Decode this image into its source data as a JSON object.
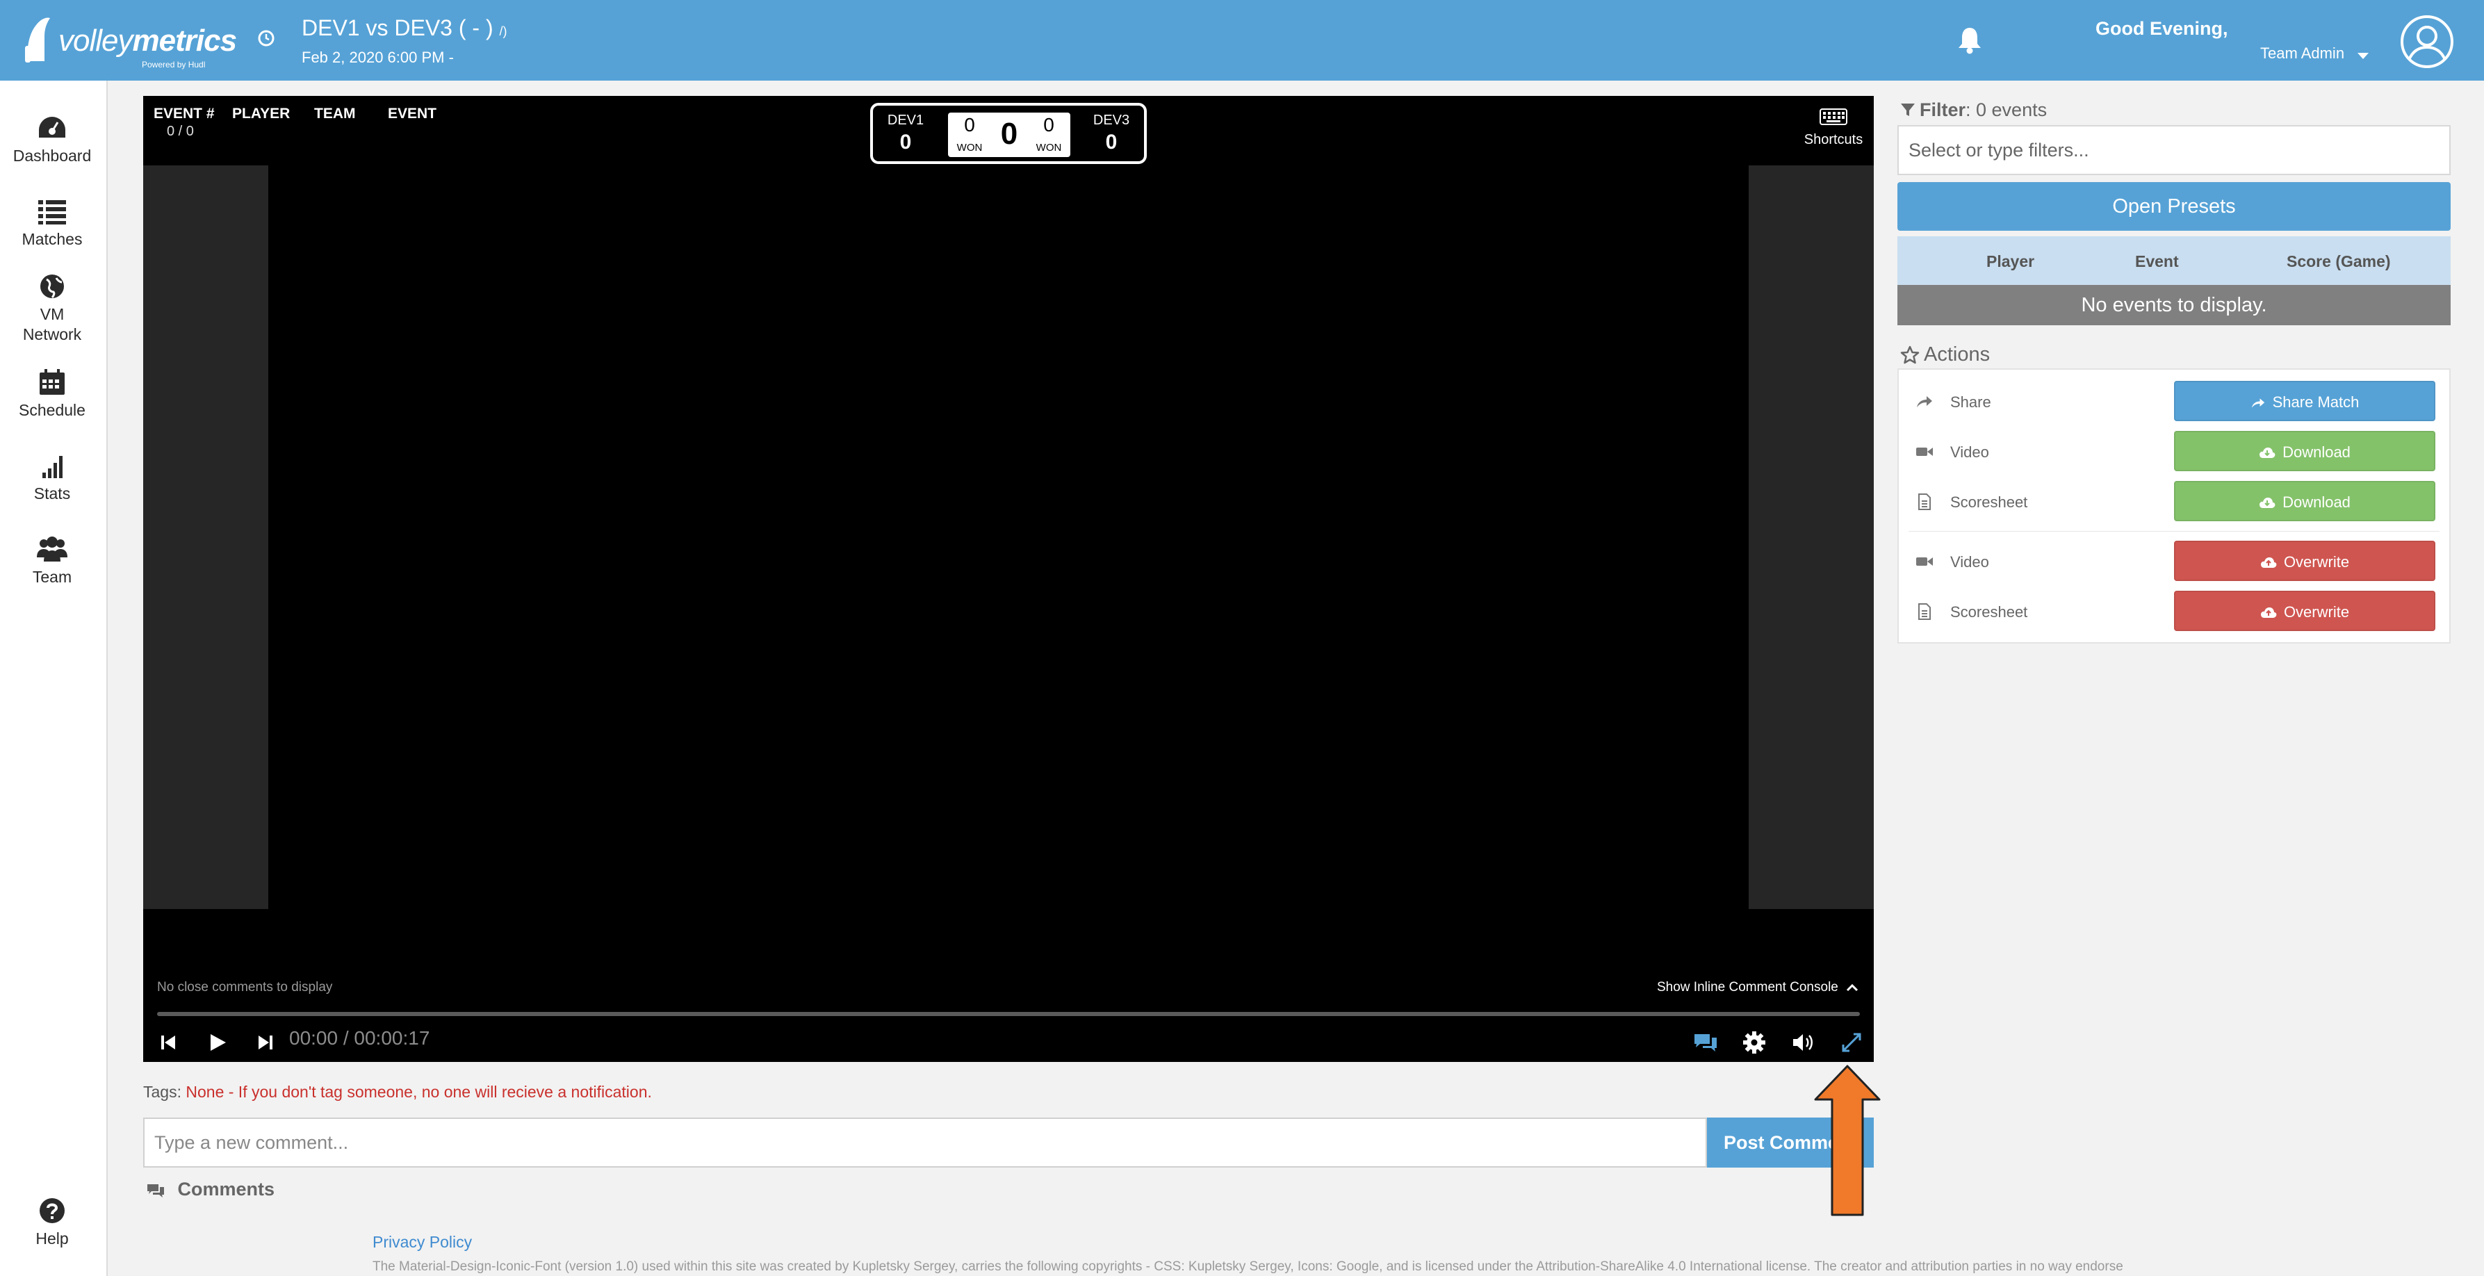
{
  "brand": {
    "name_prefix": "volley",
    "name_suffix": "metrics",
    "powered": "Powered by Hudl"
  },
  "header": {
    "match_title": "DEV1 vs DEV3 ( - )",
    "match_title_mark": "/)",
    "match_date": "Feb 2, 2020 6:00 PM -",
    "greeting": "Good Evening,",
    "user_role": "Team Admin",
    "colors": {
      "bar": "#56a2d6"
    }
  },
  "sidebar": {
    "items": [
      {
        "label": "Dashboard",
        "icon": "dashboard-icon"
      },
      {
        "label": "Matches",
        "icon": "list-icon"
      },
      {
        "label": "VM Network",
        "icon": "globe-icon"
      },
      {
        "label": "Schedule",
        "icon": "calendar-icon"
      },
      {
        "label": "Stats",
        "icon": "signal-bars-icon"
      },
      {
        "label": "Team",
        "icon": "group-icon"
      },
      {
        "label": "Help",
        "icon": "help-icon"
      }
    ]
  },
  "video": {
    "headers": {
      "event_num": "EVENT #",
      "player": "PLAYER",
      "team": "TEAM",
      "event": "EVENT"
    },
    "event_count": "0 / 0",
    "score": {
      "team_left": "DEV1",
      "team_left_points": "0",
      "team_right": "DEV3",
      "team_right_points": "0",
      "left_sets": "0",
      "right_sets": "0",
      "main": "0",
      "won_label": "WON"
    },
    "shortcuts_label": "Shortcuts",
    "close_comments": "No close comments to display",
    "inline_console": "Show Inline Comment Console",
    "timecode": "00:00 / 00:00:17",
    "progress_fraction": 0.0
  },
  "comments": {
    "tags_label": "Tags:",
    "tags_warning": "None - If you don't tag someone, no one will recieve a notification.",
    "input_placeholder": "Type a new comment...",
    "post_label": "Post Comment",
    "header": "Comments"
  },
  "footer": {
    "privacy": "Privacy Policy",
    "copyright": "The Material-Design-Iconic-Font (version 1.0) used within this site was created by Kupletsky Sergey, carries the following copyrights - CSS: Kupletsky Sergey, Icons: Google, and is licensed under the Attribution-ShareAlike 4.0 International license. The creator and attribution parties in no way endorse"
  },
  "filter": {
    "title": "Filter",
    "count": ": 0 events",
    "placeholder": "Select or type filters...",
    "presets_label": "Open Presets",
    "columns": [
      "Player",
      "Event",
      "Score (Game)"
    ],
    "empty_message": "No events to display."
  },
  "actions": {
    "title": "Actions",
    "rows": [
      {
        "label": "Share",
        "button": "Share Match",
        "color": "#56a2d6"
      },
      {
        "label": "Video",
        "button": "Download",
        "color": "#84c26a"
      },
      {
        "label": "Scoresheet",
        "button": "Download",
        "color": "#84c26a"
      },
      {
        "label": "Video",
        "button": "Overwrite",
        "color": "#cf5550"
      },
      {
        "label": "Scoresheet",
        "button": "Overwrite",
        "color": "#cf5550"
      }
    ]
  },
  "annotation": {
    "arrow_color": "#f07a2a"
  }
}
